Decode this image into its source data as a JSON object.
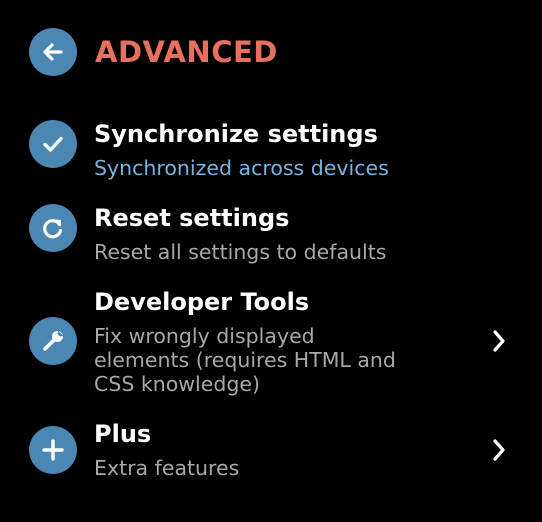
{
  "header": {
    "title": "ADVANCED",
    "back_icon": "arrow-left-icon"
  },
  "items": [
    {
      "icon": "check-icon",
      "title": "Synchronize settings",
      "subtitle": "Synchronized across devices",
      "has_chevron": false
    },
    {
      "icon": "refresh-icon",
      "title": "Reset settings",
      "subtitle": "Reset all settings to defaults",
      "has_chevron": false
    },
    {
      "icon": "wrench-icon",
      "title": "Developer Tools",
      "subtitle_lines": [
        "Fix wrongly displayed",
        "elements (requires HTML and",
        "CSS knowledge)"
      ],
      "has_chevron": true
    },
    {
      "icon": "plus-icon",
      "title": "Plus",
      "subtitle": "Extra features",
      "has_chevron": true
    }
  ],
  "colors": {
    "background": "#000000",
    "accent_title": "#e8705e",
    "icon_circle": "#4a87b3",
    "sync_status": "#79b4e0",
    "subtitle": "#a8a8a8"
  }
}
